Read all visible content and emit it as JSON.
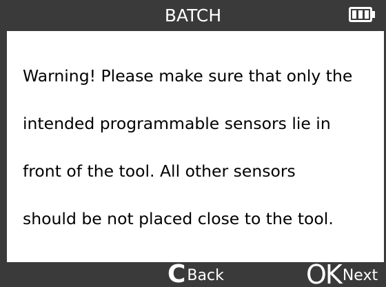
{
  "header": {
    "title": "BATCH",
    "battery_icon": "battery-full-icon"
  },
  "message": {
    "lines": [
      "Warning! Please make sure that only the",
      "intended programmable sensors lie in",
      "front of the tool. All other sensors",
      "should be not placed close to the tool."
    ]
  },
  "footer": {
    "back": {
      "glyph": "C",
      "label": "Back"
    },
    "next": {
      "glyph": "OK",
      "label": "Next"
    }
  },
  "colors": {
    "bar_background": "#3a3a3a",
    "screen_background": "#ffffff",
    "bar_text": "#ffffff",
    "body_text": "#000000"
  }
}
